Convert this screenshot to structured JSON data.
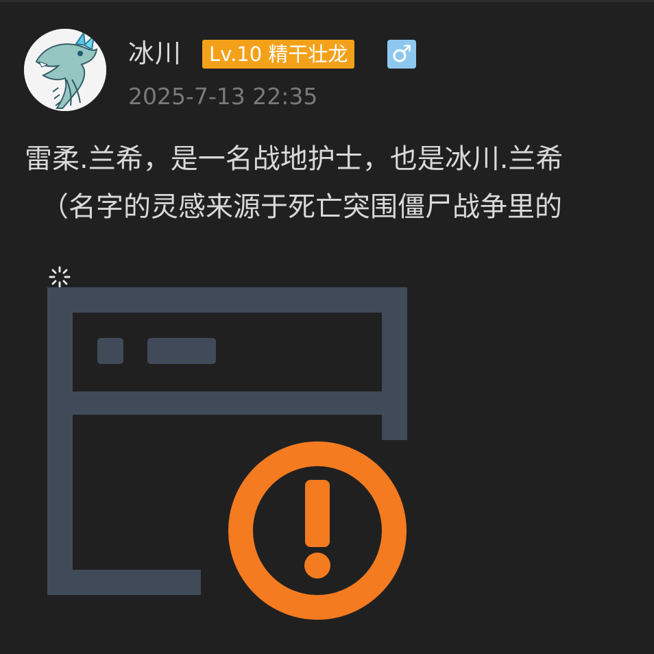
{
  "post": {
    "username": "冰川",
    "level_badge": "Lv.10 精干壮龙",
    "gender_symbol": "♂",
    "timestamp": "2025-7-13 22:35",
    "content_lines": [
      "雷柔.兰希，是一名战地护士，也是冰川.兰希",
      "（名字的灵感来源于死亡突围僵尸战争里的"
    ]
  },
  "image_placeholder": {
    "state": "load-error",
    "icon": "broken-image-icon",
    "alert_icon": "exclamation-circle-icon",
    "colors": {
      "frame": "#414a58",
      "alert": "#f47b20"
    }
  },
  "colors": {
    "background": "#202020",
    "text": "#d9d9d9",
    "muted": "#7a7a7a",
    "level_badge": "#f4a11a",
    "gender_badge": "#8ec8f0"
  }
}
